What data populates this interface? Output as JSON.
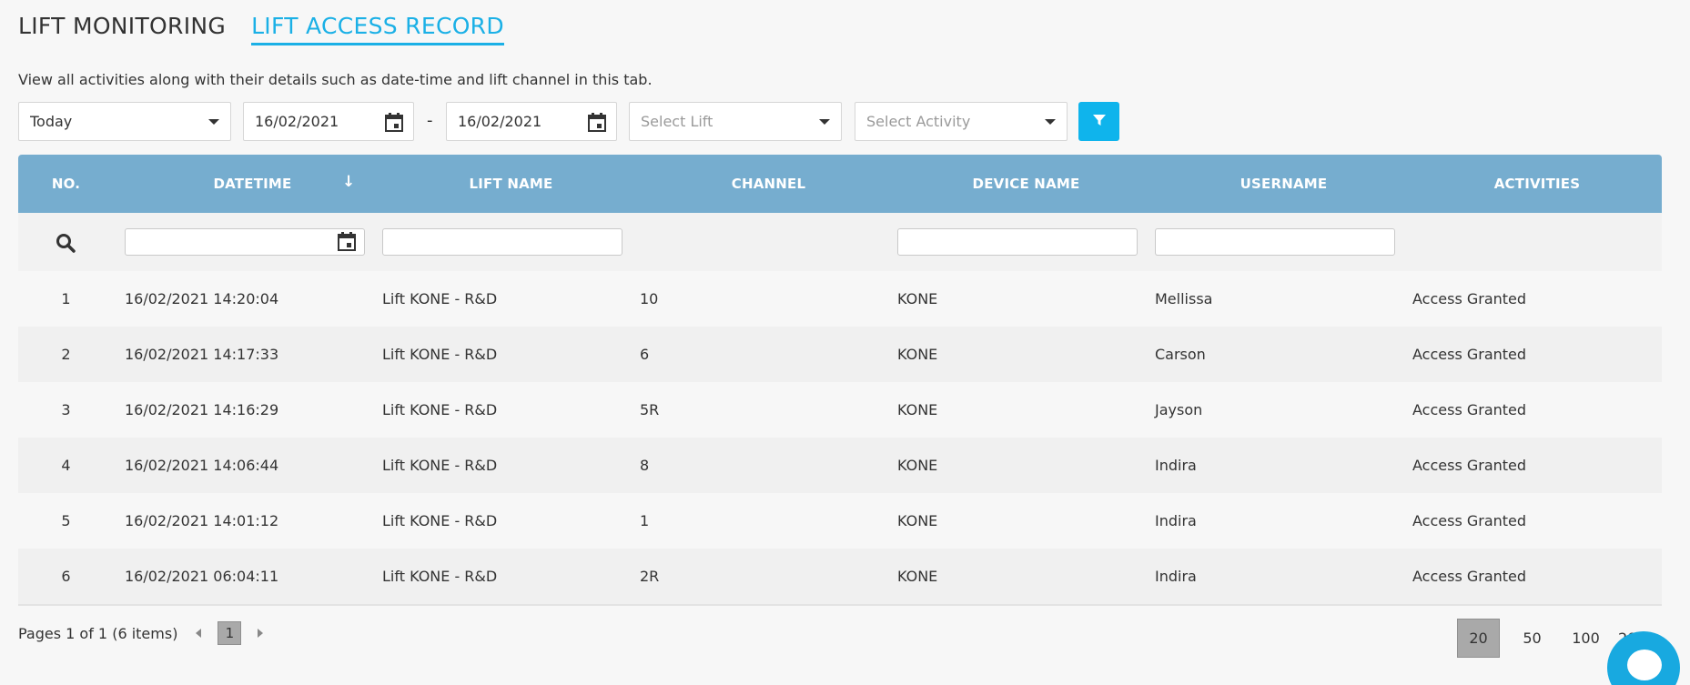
{
  "tabs": {
    "monitoring": "LIFT MONITORING",
    "access_record": "LIFT ACCESS RECORD"
  },
  "description": "View all activities along with their details such as date-time and lift channel in this tab.",
  "filters": {
    "period": "Today",
    "date_from": "16/02/2021",
    "separator": "-",
    "date_to": "16/02/2021",
    "lift_placeholder": "Select Lift",
    "activity_placeholder": "Select Activity"
  },
  "table": {
    "headers": {
      "no": "NO.",
      "datetime": "DATETIME",
      "lift_name": "LIFT NAME",
      "channel": "CHANNEL",
      "device_name": "DEVICE NAME",
      "username": "USERNAME",
      "activities": "ACTIVITIES"
    },
    "sort_indicator": "↓",
    "rows": [
      {
        "no": "1",
        "datetime": "16/02/2021 14:20:04",
        "lift_name": "Lift KONE - R&D",
        "channel": "10",
        "device_name": "KONE",
        "username": "Mellissa",
        "activity": "Access Granted"
      },
      {
        "no": "2",
        "datetime": "16/02/2021 14:17:33",
        "lift_name": "Lift KONE - R&D",
        "channel": "6",
        "device_name": "KONE",
        "username": "Carson",
        "activity": "Access Granted"
      },
      {
        "no": "3",
        "datetime": "16/02/2021 14:16:29",
        "lift_name": "Lift KONE - R&D",
        "channel": "5R",
        "device_name": "KONE",
        "username": "Jayson",
        "activity": "Access Granted"
      },
      {
        "no": "4",
        "datetime": "16/02/2021 14:06:44",
        "lift_name": "Lift KONE - R&D",
        "channel": "8",
        "device_name": "KONE",
        "username": "Indira",
        "activity": "Access Granted"
      },
      {
        "no": "5",
        "datetime": "16/02/2021 14:01:12",
        "lift_name": "Lift KONE - R&D",
        "channel": "1",
        "device_name": "KONE",
        "username": "Indira",
        "activity": "Access Granted"
      },
      {
        "no": "6",
        "datetime": "16/02/2021 06:04:11",
        "lift_name": "Lift KONE - R&D",
        "channel": "2R",
        "device_name": "KONE",
        "username": "Indira",
        "activity": "Access Granted"
      }
    ]
  },
  "pager": {
    "info": "Pages 1 of 1 (6 items)",
    "current_page": "1",
    "page_sizes": [
      "20",
      "50",
      "100",
      "20"
    ],
    "selected_size": "20"
  },
  "colors": {
    "accent": "#1bb0e6",
    "header_bg": "#76adcf",
    "filter_button": "#0fb4ec"
  },
  "icons": {
    "calendar": "calendar-icon",
    "search": "search-icon",
    "filter": "filter-icon",
    "chat": "chat-icon"
  }
}
